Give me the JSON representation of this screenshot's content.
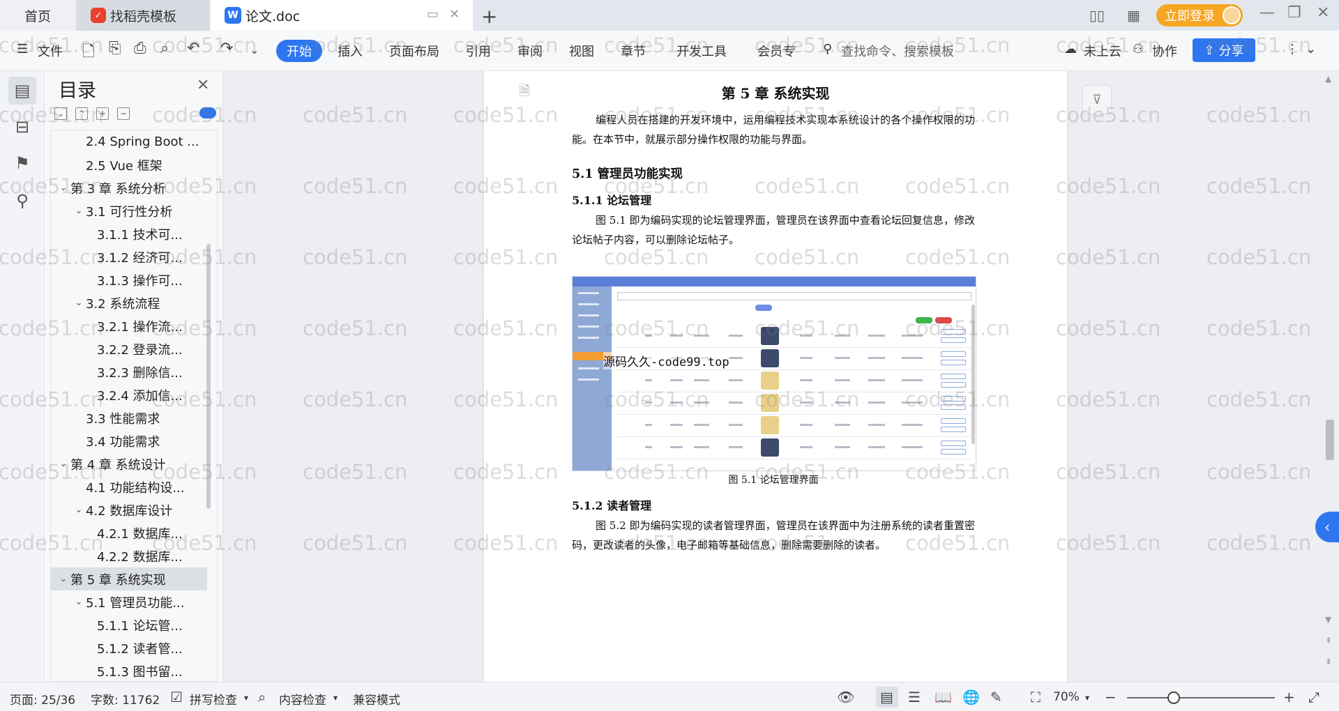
{
  "tabs": {
    "home": "首页",
    "template": "找稻壳模板",
    "document": "论文.doc"
  },
  "titlebar": {
    "login": "立即登录"
  },
  "toolbar": {
    "file": "文件",
    "items": [
      "开始",
      "插入",
      "页面布局",
      "引用",
      "审阅",
      "视图",
      "章节",
      "开发工具",
      "会员专"
    ],
    "search_placeholder": "查找命令、搜索模板",
    "cloud": "未上云",
    "collab": "协作",
    "share": "分享"
  },
  "toc": {
    "title": "目录",
    "items": [
      {
        "label": "2.4 Spring Boot ...",
        "level": 2,
        "chevron": ""
      },
      {
        "label": "2.5 Vue 框架",
        "level": 2,
        "chevron": ""
      },
      {
        "label": "第 3 章  系统分析",
        "level": 1,
        "chevron": "down"
      },
      {
        "label": "3.1  可行性分析",
        "level": 2,
        "chevron": "down"
      },
      {
        "label": "3.1.1  技术可...",
        "level": 3,
        "chevron": ""
      },
      {
        "label": "3.1.2  经济可...",
        "level": 3,
        "chevron": ""
      },
      {
        "label": "3.1.3  操作可...",
        "level": 3,
        "chevron": ""
      },
      {
        "label": "3.2  系统流程",
        "level": 2,
        "chevron": "down"
      },
      {
        "label": "3.2.1  操作流...",
        "level": 3,
        "chevron": ""
      },
      {
        "label": "3.2.2  登录流...",
        "level": 3,
        "chevron": ""
      },
      {
        "label": "3.2.3  删除信...",
        "level": 3,
        "chevron": ""
      },
      {
        "label": "3.2.4  添加信...",
        "level": 3,
        "chevron": ""
      },
      {
        "label": "3.3  性能需求",
        "level": 2,
        "chevron": ""
      },
      {
        "label": "3.4  功能需求",
        "level": 2,
        "chevron": ""
      },
      {
        "label": "第 4 章  系统设计",
        "level": 1,
        "chevron": "down"
      },
      {
        "label": "4.1  功能结构设...",
        "level": 2,
        "chevron": ""
      },
      {
        "label": "4.2  数据库设计",
        "level": 2,
        "chevron": "down"
      },
      {
        "label": "4.2.1  数据库...",
        "level": 3,
        "chevron": ""
      },
      {
        "label": "4.2.2  数据库...",
        "level": 3,
        "chevron": ""
      },
      {
        "label": "第 5 章  系统实现",
        "level": 1,
        "chevron": "down",
        "selected": true
      },
      {
        "label": "5.1  管理员功能...",
        "level": 2,
        "chevron": "down"
      },
      {
        "label": "5.1.1  论坛管...",
        "level": 3,
        "chevron": ""
      },
      {
        "label": "5.1.2  读者管...",
        "level": 3,
        "chevron": ""
      },
      {
        "label": "5.1.3  图书留...",
        "level": 3,
        "chevron": ""
      }
    ]
  },
  "document": {
    "chapter_title": "第 5 章  系统实现",
    "intro": "编程人员在搭建的开发环境中，运用编程技术实现本系统设计的各个操作权限的功能。在本节中，就展示部分操作权限的功能与界面。",
    "section_5_1": "5.1  管理员功能实现",
    "section_5_1_1": "5.1.1  论坛管理",
    "para_5_1_1": "图 5.1  即为编码实现的论坛管理界面，管理员在该界面中查看论坛回复信息，修改论坛帖子内容，可以删除论坛帖子。",
    "figure_overlay": "源码久久-code99.top",
    "caption_5_1": "图 5.1  论坛管理界面",
    "section_5_1_2": "5.1.2  读者管理",
    "para_5_1_2": "图 5.2  即为编码实现的读者管理界面，管理员在该界面中为注册系统的读者重置密码，更改读者的头像，电子邮箱等基础信息，删除需要删除的读者。"
  },
  "watermark": "code51.cn",
  "statusbar": {
    "page": "页面: 25/36",
    "words": "字数: 11762",
    "spell": "拼写检查",
    "content_check": "内容检查",
    "compat": "兼容模式",
    "zoom": "70%"
  },
  "colors": {
    "accent": "#2e76f0",
    "login": "#f5a623",
    "figure_nav": "#8ea9d6",
    "figure_selected": "#f39c32"
  }
}
